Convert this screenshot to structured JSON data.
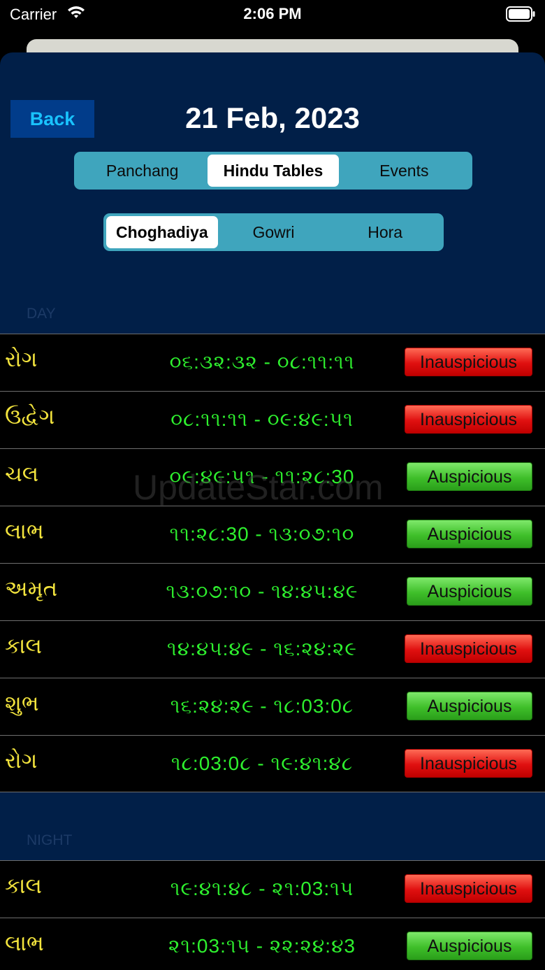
{
  "status": {
    "carrier": "Carrier",
    "time": "2:06 PM"
  },
  "header": {
    "back_label": "Back",
    "date": "21 Feb, 2023"
  },
  "tabs": [
    {
      "label": "Panchang",
      "active": false
    },
    {
      "label": "Hindu Tables",
      "active": true
    },
    {
      "label": "Events",
      "active": false
    }
  ],
  "subtabs": [
    {
      "label": "Choghadiya",
      "active": true
    },
    {
      "label": "Gowri",
      "active": false
    },
    {
      "label": "Hora",
      "active": false
    }
  ],
  "day": {
    "title": "DAY",
    "rows": [
      {
        "name": "રોગ",
        "range": "૦૬:૩૨:૩૨ - ૦૮:૧૧:૧૧",
        "status": "Inauspicious",
        "good": false
      },
      {
        "name": "ઉદ્વેગ",
        "range": "૦૮:૧૧:૧૧ - ૦૯:૪૯:૫૧",
        "status": "Inauspicious",
        "good": false
      },
      {
        "name": "ચલ",
        "range": "૦૯:૪૯:૫૧ - ૧૧:૨૮:30",
        "status": "Auspicious",
        "good": true
      },
      {
        "name": "લાભ",
        "range": "૧૧:૨૮:30 - ૧૩:૦૭:૧૦",
        "status": "Auspicious",
        "good": true
      },
      {
        "name": "અમૃત",
        "range": "૧૩:૦૭:૧૦ - ૧૪:૪૫:૪૯",
        "status": "Auspicious",
        "good": true
      },
      {
        "name": "કાલ",
        "range": "૧૪:૪૫:૪૯ - ૧૬:૨૪:૨૯",
        "status": "Inauspicious",
        "good": false
      },
      {
        "name": "શુભ",
        "range": "૧૬:૨૪:૨૯ - ૧૮:03:0૮",
        "status": "Auspicious",
        "good": true
      },
      {
        "name": "રોગ",
        "range": "૧૮:03:0૮ - ૧૯:૪૧:૪૮",
        "status": "Inauspicious",
        "good": false
      }
    ]
  },
  "night": {
    "title": "NIGHT",
    "rows": [
      {
        "name": "કાલ",
        "range": "૧૯:૪૧:૪૮ - ૨૧:03:૧૫",
        "status": "Inauspicious",
        "good": false
      },
      {
        "name": "લાભ",
        "range": "૨૧:03:૧૫ - ૨૨:૨૪:૪3",
        "status": "Auspicious",
        "good": true
      }
    ]
  },
  "watermark": "UpdateStar.com",
  "colors": {
    "sheet": "#011f48",
    "accent": "#3fa5bd",
    "name": "#f2e33d",
    "time": "#2ef02e"
  }
}
